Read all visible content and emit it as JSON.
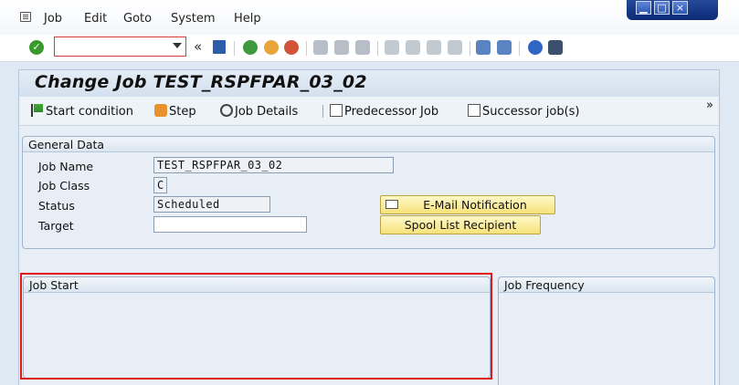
{
  "menu": {
    "items": [
      "Job",
      "Edit",
      "Goto",
      "System",
      "Help"
    ]
  },
  "window_controls": {
    "minimize_label": "▁",
    "maximize_label": "□",
    "close_label": "×"
  },
  "toolbar": {
    "command_field_value": "",
    "back_chevron": "«"
  },
  "title": "Change Job TEST_RSPFPAR_03_02",
  "app_toolbar": {
    "start_condition": "Start condition",
    "step": "Step",
    "job_details": "Job Details",
    "predecessor_job": "Predecessor Job",
    "successor_jobs": "Successor job(s)",
    "more": "»"
  },
  "general_data": {
    "title": "General Data",
    "job_name_label": "Job Name",
    "job_name_value": "TEST_RSPFPAR_03_02",
    "job_class_label": "Job Class",
    "job_class_value": "C",
    "status_label": "Status",
    "status_value": "Scheduled",
    "target_label": "Target",
    "target_value": "",
    "email_button": "E-Mail Notification",
    "spool_button": "Spool List Recipient"
  },
  "job_start": {
    "title": "Job Start"
  },
  "job_frequency": {
    "title": "Job Frequency"
  },
  "colors": {
    "highlight": "#e0191b",
    "button_yellow": "#f6e27a",
    "header_blue": "#d3e0ee"
  }
}
